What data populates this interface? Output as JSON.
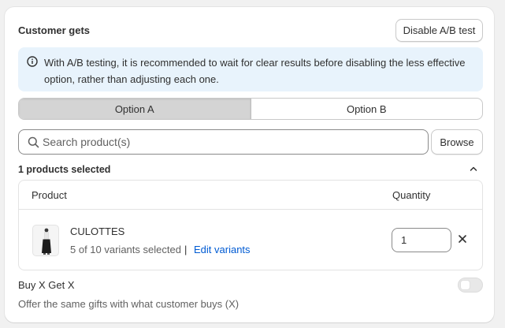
{
  "section": {
    "title": "Customer gets",
    "disable_button": "Disable A/B test"
  },
  "banner": {
    "icon": "info-icon",
    "text": "With A/B testing, it is recommended to wait for clear results before disabling the less effective option, rather than adjusting each one."
  },
  "options": {
    "selected": "Option A",
    "items": [
      {
        "label": "Option A"
      },
      {
        "label": "Option B"
      }
    ]
  },
  "search": {
    "placeholder": "Search product(s)",
    "value": "",
    "browse_label": "Browse"
  },
  "selection": {
    "count_text": "1 products selected",
    "expanded": true
  },
  "table": {
    "columns": [
      "Product",
      "Quantity"
    ],
    "rows": [
      {
        "name": "CULOTTES",
        "variants_text": "5 of 10 variants selected",
        "separator": "|",
        "edit_label": "Edit variants",
        "quantity": "1"
      }
    ]
  },
  "buy_x_get_x": {
    "label": "Buy X Get X",
    "description": "Offer the same gifts with what customer buys (X)",
    "enabled": false
  },
  "colors": {
    "banner_bg": "#e8f3fc",
    "link": "#005bd3",
    "active_segment": "#d4d4d4"
  }
}
